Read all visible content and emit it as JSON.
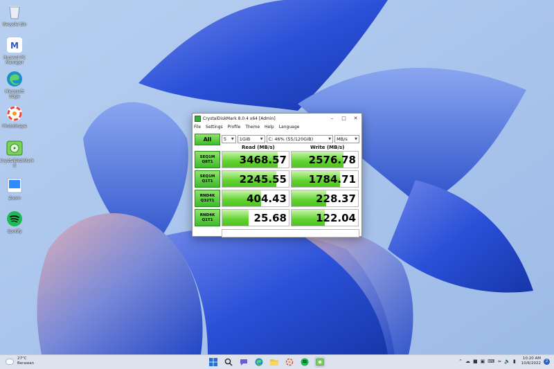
{
  "desktop": {
    "icons": [
      {
        "label": "Recycle Bin",
        "icon": "recycle-bin-icon"
      },
      {
        "label": "Huawei PC Manager",
        "icon": "huawei-pc-manager-icon"
      },
      {
        "label": "Microsoft Edge",
        "icon": "edge-icon"
      },
      {
        "label": "PhotoScape",
        "icon": "photoscape-icon"
      },
      {
        "label": "CrystalDiskMark 8",
        "icon": "crystaldiskmark-icon"
      },
      {
        "label": "Zoom",
        "icon": "zoom-icon"
      },
      {
        "label": "Spotify",
        "icon": "spotify-icon"
      }
    ]
  },
  "window": {
    "title": "CrystalDiskMark 8.0.4 x64 [Admin]",
    "menu": [
      "File",
      "Settings",
      "Profile",
      "Theme",
      "Help",
      "Language"
    ],
    "controls": {
      "all_label": "All",
      "count": "5",
      "size": "1GiB",
      "drive": "C: 46% (55/120GiB)",
      "unit": "MB/s"
    },
    "headers": {
      "read": "Read (MB/s)",
      "write": "Write (MB/s)"
    },
    "rows": [
      {
        "line1": "SEQ1M",
        "line2": "Q8T1",
        "read": "3468.57",
        "write": "2576.78",
        "read_fill": 0.83,
        "write_fill": 0.78
      },
      {
        "line1": "SEQ1M",
        "line2": "Q1T1",
        "read": "2245.55",
        "write": "1784.71",
        "read_fill": 0.81,
        "write_fill": 0.73
      },
      {
        "line1": "RND4K",
        "line2": "Q32T1",
        "read": "404.43",
        "write": "228.37",
        "read_fill": 0.58,
        "write_fill": 0.52
      },
      {
        "line1": "RND4K",
        "line2": "Q1T1",
        "read": "25.68",
        "write": "122.04",
        "read_fill": 0.4,
        "write_fill": 0.5
      }
    ]
  },
  "taskbar": {
    "weather": {
      "temp": "27°C",
      "condition": "Berawan"
    },
    "apps": [
      "start-icon",
      "search-icon",
      "chat-icon",
      "edge-icon",
      "file-explorer-icon",
      "photoscape-icon",
      "spotify-icon",
      "crystaldiskmark-icon"
    ],
    "clock": {
      "time": "10:20 AM",
      "date": "10/6/2022"
    },
    "notifications": "2"
  },
  "colors": {
    "bar_green": "#62d232",
    "label_green": "#3dbb2a",
    "wallpaper_blue": "#2f5ae0"
  }
}
